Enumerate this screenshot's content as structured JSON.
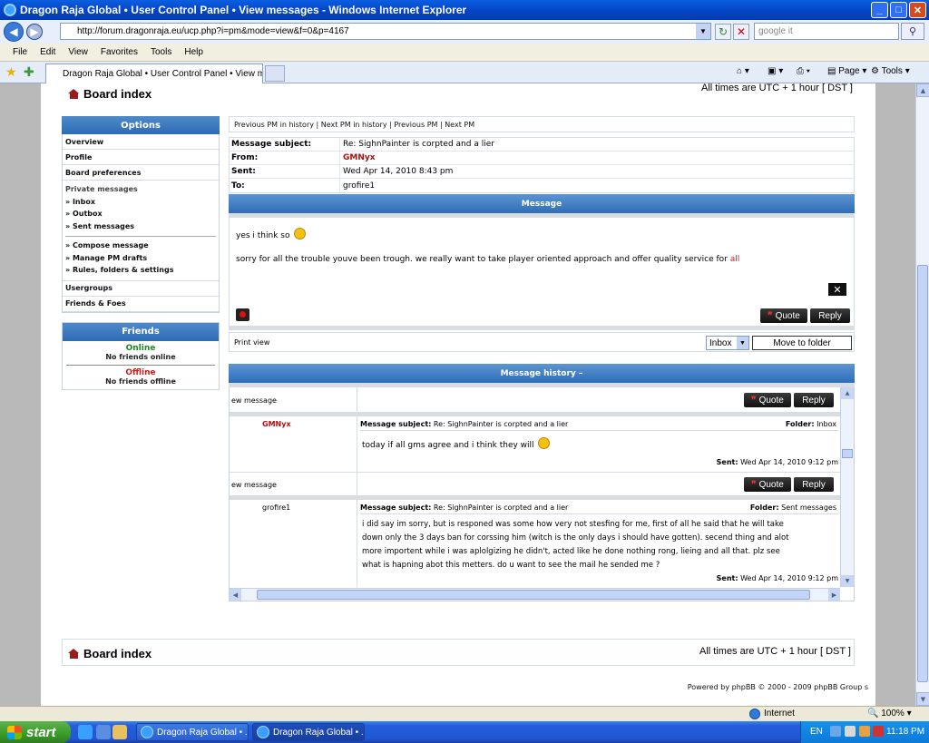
{
  "window": {
    "title": "Dragon Raja Global • User Control Panel • View messages - Windows Internet Explorer",
    "minimize": "_",
    "maximize": "□",
    "close": "✕"
  },
  "address_bar": {
    "url": "http://forum.dragonraja.eu/ucp.php?i=pm&mode=view&f=0&p=4167",
    "search_placeholder": "google it"
  },
  "menu": [
    "File",
    "Edit",
    "View",
    "Favorites",
    "Tools",
    "Help"
  ],
  "tab": {
    "label": "Dragon Raja Global • User Control Panel • View messa..."
  },
  "command_bar": {
    "page": "Page",
    "tools": "Tools"
  },
  "header": {
    "board_index": "Board index",
    "timezone": "All times are UTC + 1 hour [ DST ]"
  },
  "sidebar": {
    "options_title": "Options",
    "items": [
      "Overview",
      "Profile",
      "Board preferences"
    ],
    "private_messages": {
      "title": "Private messages",
      "folders": [
        "» Inbox",
        "» Outbox",
        "» Sent messages"
      ],
      "actions": [
        "» Compose message",
        "» Manage PM drafts",
        "» Rules, folders & settings"
      ]
    },
    "items_after": [
      "Usergroups",
      "Friends & Foes"
    ],
    "friends": {
      "title": "Friends",
      "online": "Online",
      "no_online": "No friends online",
      "offline": "Offline",
      "no_offline": "No friends offline"
    }
  },
  "pm_nav": "Previous PM in history | Next PM in history | Previous PM | Next PM",
  "message": {
    "subject_label": "Message subject:",
    "subject": "Re: SighnPainter is corpted and a lier",
    "from_label": "From:",
    "from": "GMNyx",
    "sent_label": "Sent:",
    "sent": "Wed Apr 14, 2010 8:43 pm",
    "to_label": "To:",
    "to": "grofire1",
    "section_title": "Message",
    "body_line1": "yes i think so",
    "body_line2": "sorry for all the trouble youve been trough. we really want to take player oriented approach and offer quality service for",
    "body_line2_highlight": "all",
    "close_btn": "✕",
    "quote": "Quote",
    "reply": "Reply"
  },
  "print_row": {
    "print_view": "Print view",
    "folder_select": "Inbox",
    "move_button": "Move to folder"
  },
  "history": {
    "title": "Message history –",
    "entries": [
      {
        "view_label": "ew message",
        "author": "GMNyx",
        "subject_label": "Message subject:",
        "subject": "Re: SighnPainter is corpted and a lier",
        "folder_label": "Folder:",
        "folder": "Inbox",
        "body": "today if all gms agree and i think they will",
        "sent_label": "Sent:",
        "sent": "Wed Apr 14, 2010 9:12 pm"
      },
      {
        "view_label": "ew message",
        "author": "grofire1",
        "subject_label": "Message subject:",
        "subject": "Re: SighnPainter is corpted and a lier",
        "folder_label": "Folder:",
        "folder": "Sent messages",
        "body_lines": [
          "i did say im sorry, but is responed was some how very not stesfing for me, first of all he said that he will take",
          "down only the 3 days ban for corssing him (witch is the only days i should have gotten). secend thing and alot",
          "more importent while i was aplolgizing he didn't, acted like he done nothing rong, lieing and all that. plz see",
          "what is hapning abot this metters. do u want to see the mail he sended me ?"
        ],
        "sent_label": "Sent:",
        "sent": "Wed Apr 14, 2010 9:12 pm"
      }
    ]
  },
  "footer": {
    "board_index": "Board index",
    "timezone": "All times are UTC + 1 hour [ DST ]",
    "powered": "Powered by phpBB © 2000 - 2009 phpBB Group  s"
  },
  "status_bar": {
    "zone": "Internet",
    "zoom": "100%"
  },
  "taskbar": {
    "start": "start",
    "tasks": [
      "Dragon Raja Global • ...",
      "Dragon Raja Global • ..."
    ],
    "lang": "EN",
    "clock": "11:18 PM"
  },
  "colors": {
    "accent_blue": "#2f6db5",
    "author_red": "#aa1111",
    "online_green": "#1a8a1a",
    "offline_red": "#cc1f1f"
  }
}
